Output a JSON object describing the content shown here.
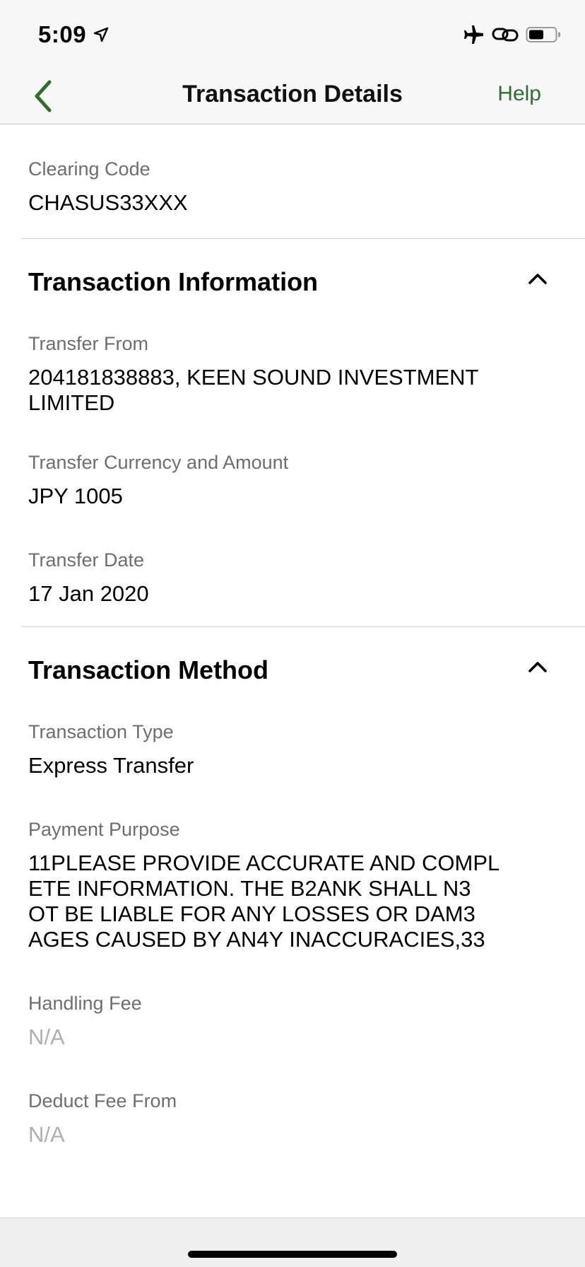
{
  "status": {
    "time": "5:09"
  },
  "nav": {
    "title": "Transaction Details",
    "help_label": "Help"
  },
  "clearing": {
    "label": "Clearing Code",
    "value": "CHASUS33XXX"
  },
  "info_section": {
    "title": "Transaction Information",
    "transfer_from": {
      "label": "Transfer From",
      "line1": "204181838883, KEEN SOUND INVESTMENT",
      "line2": "LIMITED"
    },
    "currency_amount": {
      "label": "Transfer Currency and Amount",
      "value": "JPY 1005"
    },
    "transfer_date": {
      "label": "Transfer Date",
      "value": "17 Jan 2020"
    }
  },
  "method_section": {
    "title": "Transaction Method",
    "transaction_type": {
      "label": "Transaction Type",
      "value": "Express Transfer"
    },
    "payment_purpose": {
      "label": "Payment Purpose",
      "lines": [
        "11PLEASE PROVIDE ACCURATE AND COMPL",
        "ETE INFORMATION. THE B2ANK SHALL N3",
        "OT BE LIABLE FOR ANY LOSSES OR DAM3",
        "AGES CAUSED BY AN4Y INACCURACIES,33"
      ]
    },
    "handling_fee": {
      "label": "Handling Fee",
      "value": "N/A"
    },
    "deduct_fee_from": {
      "label": "Deduct Fee From",
      "value": "N/A"
    }
  },
  "colors": {
    "accent": "#2f6e2c",
    "label_gray": "#6e6e6e",
    "muted": "#b0b0b0"
  }
}
